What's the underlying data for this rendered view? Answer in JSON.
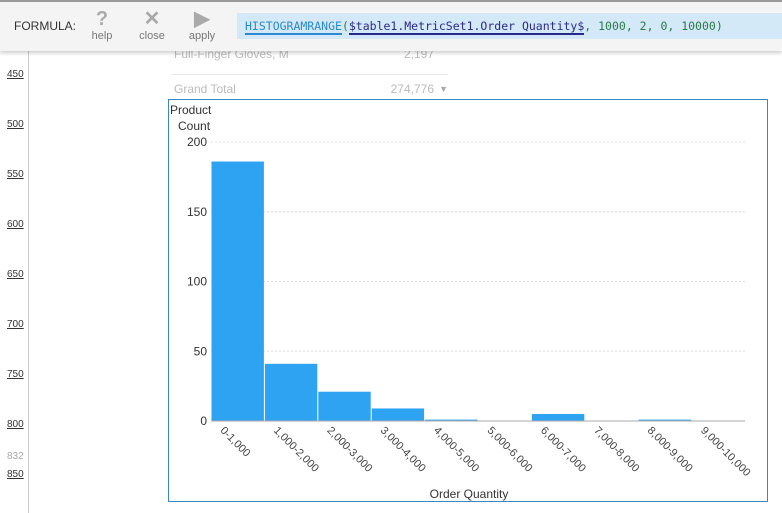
{
  "toolbar": {
    "formula_label": "FORMULA:",
    "help": "help",
    "close": "close",
    "apply": "apply",
    "formula": {
      "function": "HISTOGRAMRANGE",
      "open": "(",
      "reference": "$table1.MetricSet1.Order Quantity$",
      "args": ", 1000, 2, 0, 10000)"
    }
  },
  "ruler": {
    "labels": [
      "450",
      "500",
      "550",
      "600",
      "650",
      "700",
      "750",
      "800",
      "832",
      "850"
    ]
  },
  "table": {
    "row_label": "Full-Finger Gloves, M",
    "row_value": "2,197",
    "total_label": "Grand Total",
    "total_value": "274,776"
  },
  "chart_data": {
    "type": "bar",
    "ylabel": "Product Count",
    "xlabel": "Order Quantity",
    "categories": [
      "0-1,000",
      "1,000-2,000",
      "2,000-3,000",
      "3,000-4,000",
      "4,000-5,000",
      "5,000-6,000",
      "6,000-7,000",
      "7,000-8,000",
      "8,000-9,000",
      "9,000-10,000"
    ],
    "values": [
      186,
      41,
      21,
      9,
      1,
      0,
      5,
      0,
      1,
      0
    ],
    "ylim": [
      0,
      200
    ],
    "yticks": [
      0,
      50,
      100,
      150,
      200
    ],
    "grid": true,
    "color": "#2ea3f2"
  }
}
